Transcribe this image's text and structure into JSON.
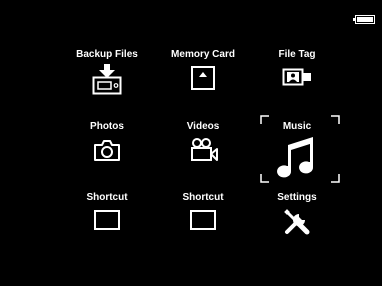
{
  "status": {
    "battery_icon": "battery-icon"
  },
  "menu": {
    "items": [
      {
        "label": "Backup Files",
        "icon": "backup-files-icon"
      },
      {
        "label": "Memory Card",
        "icon": "memory-card-icon"
      },
      {
        "label": "File Tag",
        "icon": "file-tag-icon"
      },
      {
        "label": "Photos",
        "icon": "camera-icon"
      },
      {
        "label": "Videos",
        "icon": "video-camera-icon"
      },
      {
        "label": "Music",
        "icon": "music-note-icon",
        "selected": true
      },
      {
        "label": "Shortcut",
        "icon": "empty-shortcut-icon"
      },
      {
        "label": "Shortcut",
        "icon": "empty-shortcut-icon"
      },
      {
        "label": "Settings",
        "icon": "tools-icon"
      }
    ]
  },
  "colors": {
    "background": "#000000",
    "foreground": "#ffffff"
  }
}
